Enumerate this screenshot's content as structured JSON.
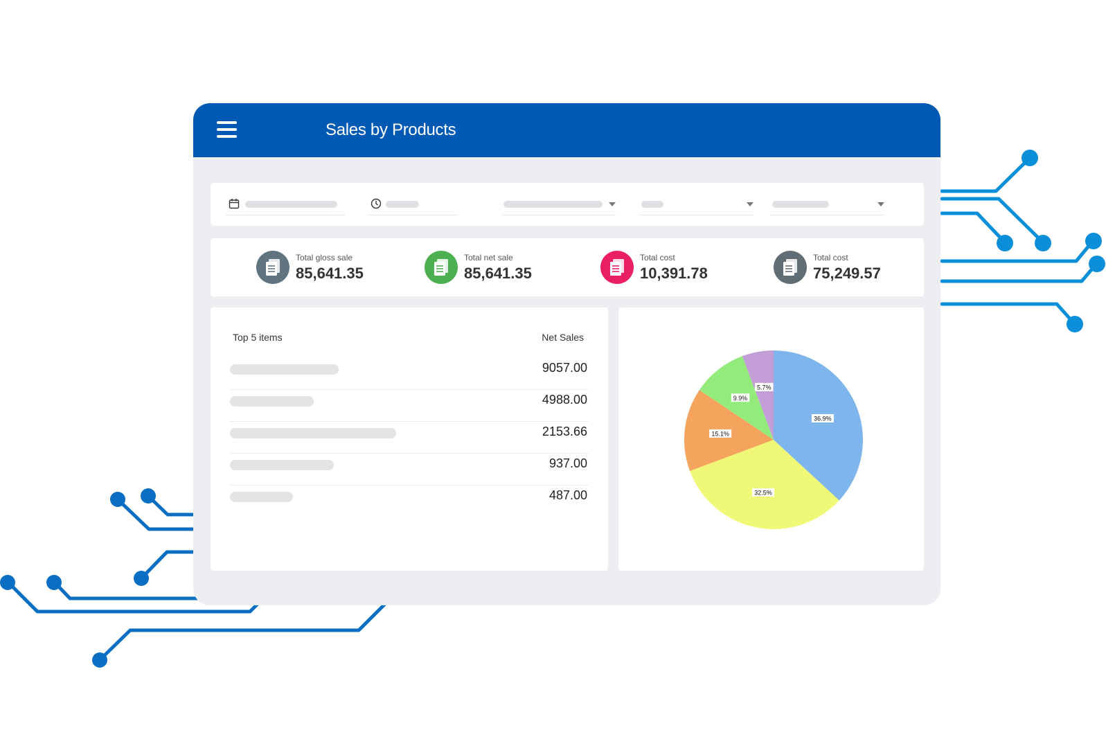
{
  "colors": {
    "appbar": "#0059b2",
    "window_bg": "#edeef1",
    "kpi_icon_gray": "#627480",
    "kpi_icon_green": "#4caf50",
    "kpi_icon_pink": "#e91e63",
    "kpi_icon_dark": "#616d75",
    "circuit_blue": "#0a7fd0"
  },
  "header": {
    "menu_icon": "hamburger-icon",
    "title": "Sales by Products"
  },
  "filters": [
    {
      "icon": "calendar-icon"
    },
    {
      "icon": "clock-icon"
    },
    {
      "icon": "chevron-down-icon"
    },
    {
      "icon": "chevron-down-icon"
    },
    {
      "icon": "chevron-down-icon"
    }
  ],
  "kpis": [
    {
      "label": "Total gloss sale",
      "value": "85,641.35",
      "icon": "document-icon",
      "color": "#627480"
    },
    {
      "label": "Total net sale",
      "value": "85,641.35",
      "icon": "document-icon",
      "color": "#4caf50"
    },
    {
      "label": "Total cost",
      "value": "10,391.78",
      "icon": "document-icon",
      "color": "#e91e63"
    },
    {
      "label": "Total cost",
      "value": "75,249.57",
      "icon": "document-icon",
      "color": "#616d75"
    }
  ],
  "top_items": {
    "header_left": "Top 5 items",
    "header_right": "Net Sales",
    "rows": [
      {
        "value": "9057.00"
      },
      {
        "value": "4988.00"
      },
      {
        "value": "2153.66"
      },
      {
        "value": "937.00"
      },
      {
        "value": "487.00"
      }
    ]
  },
  "chart_data": {
    "type": "pie",
    "title": "",
    "slices": [
      {
        "value": 36.9,
        "label": "36.9%",
        "color": "#7eb5ec"
      },
      {
        "value": 32.5,
        "label": "32.5%",
        "color": "#f0f878"
      },
      {
        "value": 15.1,
        "label": "15.1%",
        "color": "#f5a45d"
      },
      {
        "value": 9.9,
        "label": "9.9%",
        "color": "#93eb7c"
      },
      {
        "value": 5.7,
        "label": "5.7%",
        "color": "#c39ed6"
      }
    ]
  }
}
